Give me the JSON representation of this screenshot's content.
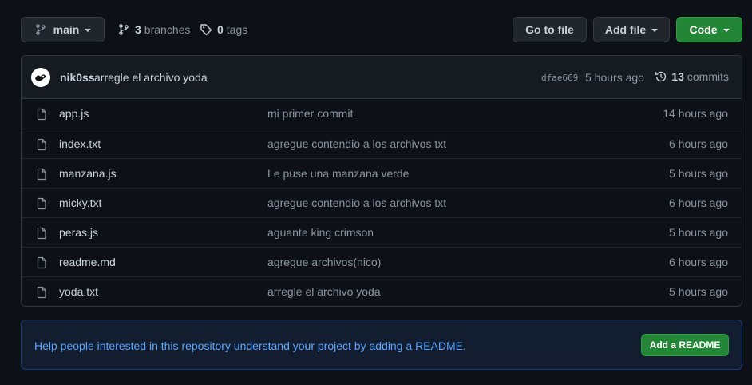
{
  "toolbar": {
    "branch_label": "main",
    "branches_count": "3",
    "branches_label": "branches",
    "tags_count": "0",
    "tags_label": "tags",
    "go_to_file_label": "Go to file",
    "add_file_label": "Add file",
    "code_label": "Code"
  },
  "latest_commit": {
    "author": "nik0ss",
    "message": "arregle el archivo yoda",
    "hash": "dfae669",
    "time": "5 hours ago",
    "commits_count": "13",
    "commits_label": "commits"
  },
  "files": [
    {
      "name": "app.js",
      "message": "mi primer commit",
      "age": "14 hours ago"
    },
    {
      "name": "index.txt",
      "message": "agregue contendio a los archivos txt",
      "age": "6 hours ago"
    },
    {
      "name": "manzana.js",
      "message": "Le puse una manzana verde",
      "age": "5 hours ago"
    },
    {
      "name": "micky.txt",
      "message": "agregue contendio a los archivos txt",
      "age": "6 hours ago"
    },
    {
      "name": "peras.js",
      "message": "aguante king crimson",
      "age": "5 hours ago"
    },
    {
      "name": "readme.md",
      "message": "agregue archivos(nico)",
      "age": "6 hours ago"
    },
    {
      "name": "yoda.txt",
      "message": "arregle el archivo yoda",
      "age": "5 hours ago"
    }
  ],
  "readme_banner": {
    "text": "Help people interested in this repository understand your project by adding a README.",
    "button_label": "Add a README"
  },
  "colors": {
    "background": "#0d1117",
    "accent_green": "#238636",
    "link_blue": "#58a6ff"
  },
  "icons": [
    "git-branch-icon",
    "tag-icon",
    "history-icon",
    "file-icon",
    "avatar"
  ]
}
